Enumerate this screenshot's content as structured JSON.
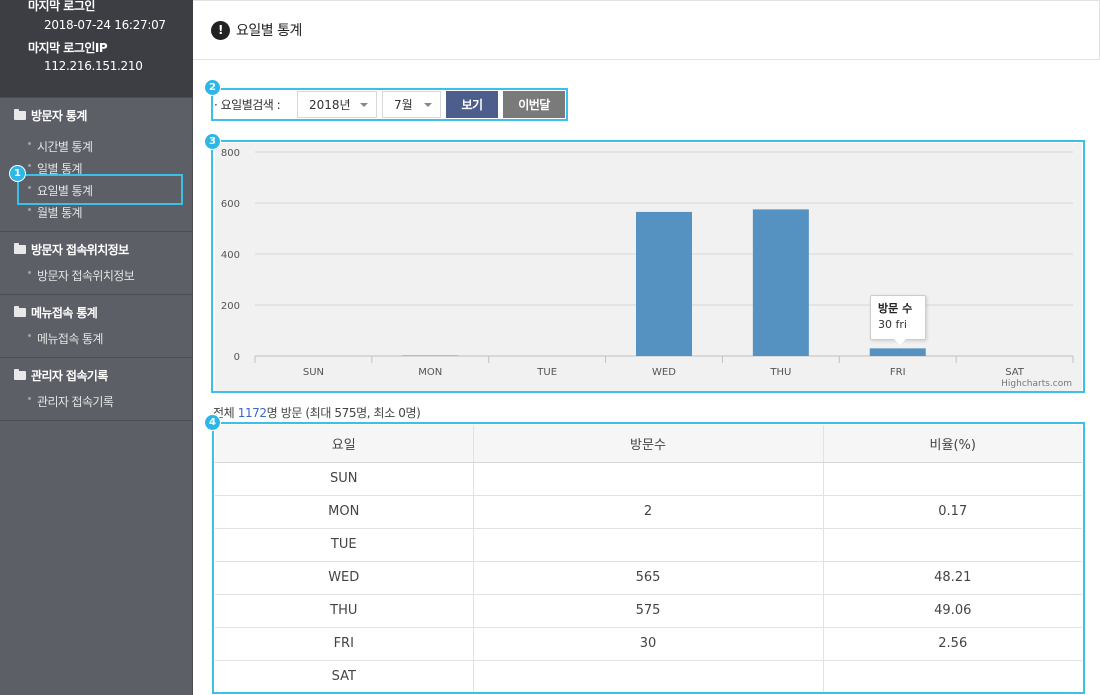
{
  "sidebar": {
    "last_login_label": "마지막 로그인",
    "last_login_value": "2018-07-24 16:27:07",
    "last_ip_label": "마지막 로그인IP",
    "last_ip_value": "112.216.151.210",
    "groups": [
      {
        "title": "방문자 통계",
        "items": [
          "시간별 통계",
          "일별 통계",
          "요일별 통계",
          "월별 통계"
        ]
      },
      {
        "title": "방문자 접속위치정보",
        "items": [
          "방문자 접속위치정보"
        ]
      },
      {
        "title": "메뉴접속 통계",
        "items": [
          "메뉴접속 통계"
        ]
      },
      {
        "title": "관리자 접속기록",
        "items": [
          "관리자 접속기록"
        ]
      }
    ]
  },
  "header": {
    "title": "요일별 통계",
    "alert_glyph": "!"
  },
  "badges": [
    "1",
    "2",
    "3",
    "4"
  ],
  "search": {
    "label": "· 요일별검색 :",
    "year": "2018년",
    "month": "7월",
    "view_button": "보기",
    "this_month_button": "이번달"
  },
  "chart_data": {
    "type": "bar",
    "categories": [
      "SUN",
      "MON",
      "TUE",
      "WED",
      "THU",
      "FRI",
      "SAT"
    ],
    "values": [
      0,
      2,
      0,
      565,
      575,
      30,
      0
    ],
    "yticks": [
      0,
      200,
      400,
      600,
      800
    ],
    "ylim": [
      0,
      800
    ],
    "color": "#5592c2",
    "credit": "Highcharts.com",
    "tooltip": {
      "title": "방문 수",
      "value": "30 fri"
    }
  },
  "summary": {
    "prefix": "전체",
    "total": "1172",
    "suffix": "명 방문 (최대 575명, 최소 0명)"
  },
  "table": {
    "headers": [
      "요일",
      "방문수",
      "비율(%)"
    ],
    "rows": [
      [
        "SUN",
        "",
        ""
      ],
      [
        "MON",
        "2",
        "0.17"
      ],
      [
        "TUE",
        "",
        ""
      ],
      [
        "WED",
        "565",
        "48.21"
      ],
      [
        "THU",
        "575",
        "49.06"
      ],
      [
        "FRI",
        "30",
        "2.56"
      ],
      [
        "SAT",
        "",
        ""
      ]
    ]
  },
  "colors": {
    "accent": "#2db7e6",
    "view_button": "#4e5e8c",
    "this_month_button": "#7a7a7a",
    "bar": "#5592c2"
  }
}
